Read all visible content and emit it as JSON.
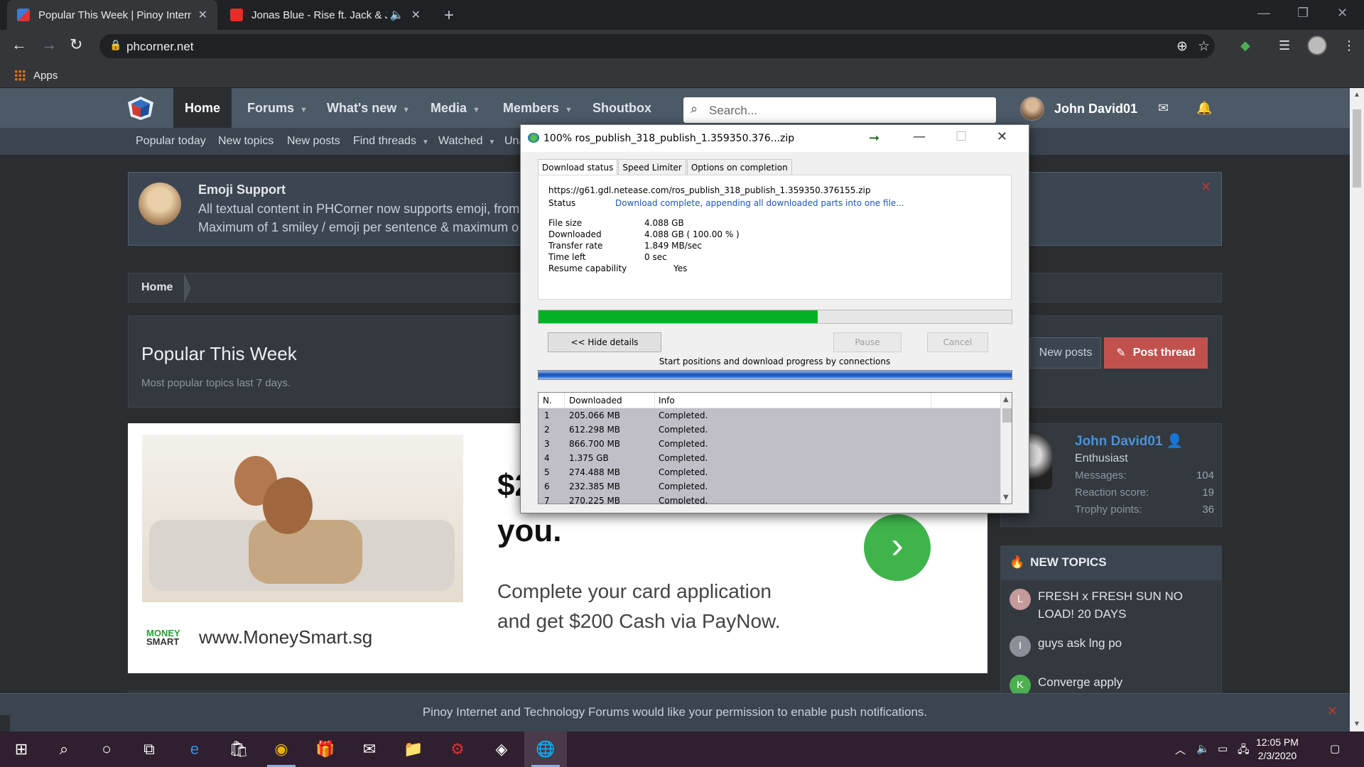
{
  "browser": {
    "tabs": [
      {
        "title": "Popular This Week | Pinoy Intern",
        "active": true
      },
      {
        "title": "Jonas Blue - Rise ft. Jack & Ja",
        "active": false
      }
    ],
    "url": "phcorner.net",
    "bookmarks_apps": "Apps"
  },
  "forum": {
    "nav": [
      "Home",
      "Forums",
      "What's new",
      "Media",
      "Members",
      "Shoutbox"
    ],
    "search_placeholder": "Search...",
    "username": "John David01",
    "subnav": [
      "Popular today",
      "New topics",
      "New posts",
      "Find threads",
      "Watched",
      "Una"
    ],
    "notice": {
      "title": "Emoji Support",
      "line1": "All textual content in PHCorner now supports emoji, from",
      "line2": "Maximum of 1 smiley / emoji per sentence & maximum o"
    },
    "breadcrumb": "Home",
    "page_title": "Popular This Week",
    "page_subtitle": "Most popular topics last 7 days.",
    "buttons": {
      "new_posts": "New posts",
      "post_thread": "Post thread"
    },
    "ad": {
      "headline_line1": "$2",
      "headline_line2": "you.",
      "copy_line1": "Complete your card application",
      "copy_line2": "and get $200 Cash via PayNow.",
      "brand_top": "MONEY",
      "brand_bottom": "SMART",
      "url": "www.MoneySmart.sg"
    },
    "user_card": {
      "name": "John David01",
      "rank": "Enthusiast",
      "stats": [
        {
          "label": "Messages:",
          "value": "104"
        },
        {
          "label": "Reaction score:",
          "value": "19"
        },
        {
          "label": "Trophy points:",
          "value": "36"
        }
      ]
    },
    "new_topics": {
      "heading": "NEW TOPICS",
      "items": [
        {
          "letter": "L",
          "title": "FRESH x FRESH SUN NO LOAD! 20 DAYS",
          "color": "#c49a9a"
        },
        {
          "letter": "I",
          "title": "guys ask lng po",
          "color": "#8a8f98"
        },
        {
          "letter": "K",
          "title": "Converge apply",
          "color": "#4caf50"
        }
      ]
    },
    "push_notice": "Pinoy Internet and Technology Forums would like your permission to enable push notifications."
  },
  "idm": {
    "title": "100% ros_publish_318_publish_1.359350.376...zip",
    "tabs": [
      "Download status",
      "Speed Limiter",
      "Options on completion"
    ],
    "url": "https://g61.gdl.netease.com/ros_publish_318_publish_1.359350.376155.zip",
    "status_label": "Status",
    "status_value": "Download complete, appending all downloaded parts into one file...",
    "fields": [
      {
        "label": "File size",
        "value": "4.088  GB"
      },
      {
        "label": "Downloaded",
        "value": "4.088  GB  ( 100.00 % )"
      },
      {
        "label": "Transfer rate",
        "value": "1.849  MB/sec"
      },
      {
        "label": "Time left",
        "value": "0 sec"
      },
      {
        "label": "Resume capability",
        "value": "Yes"
      }
    ],
    "progress_fraction": 0.59,
    "hide_details": "<< Hide details",
    "pause": "Pause",
    "cancel": "Cancel",
    "connections_label": "Start positions and download progress by connections",
    "columns": [
      "N.",
      "Downloaded",
      "Info"
    ],
    "rows": [
      {
        "n": "1",
        "downloaded": "205.066  MB",
        "info": "Completed."
      },
      {
        "n": "2",
        "downloaded": "612.298  MB",
        "info": "Completed."
      },
      {
        "n": "3",
        "downloaded": "866.700  MB",
        "info": "Completed."
      },
      {
        "n": "4",
        "downloaded": "1.375  GB",
        "info": "Completed."
      },
      {
        "n": "5",
        "downloaded": "274.488  MB",
        "info": "Completed."
      },
      {
        "n": "6",
        "downloaded": "232.385  MB",
        "info": "Completed."
      },
      {
        "n": "7",
        "downloaded": "270.225  MB",
        "info": "Completed."
      }
    ]
  },
  "taskbar": {
    "time": "12:05 PM",
    "date": "2/3/2020"
  },
  "colors": {
    "accent_blue": "#4a90d9",
    "post_button": "#c0514d",
    "idm_progress": "#06b025",
    "taskbar": "#2f1f2f"
  }
}
